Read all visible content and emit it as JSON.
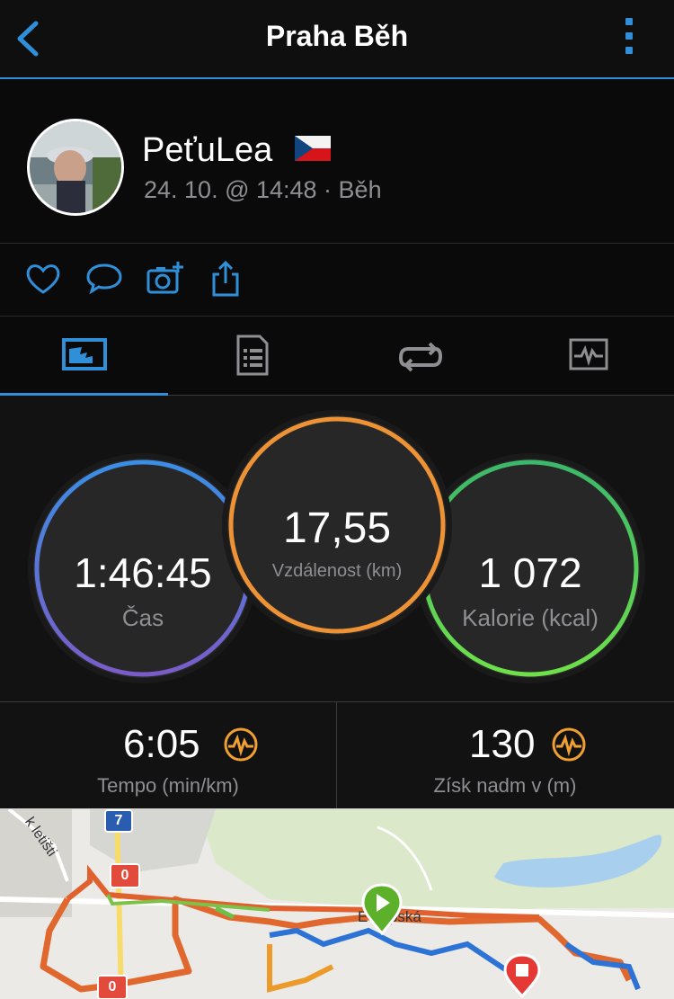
{
  "header": {
    "title": "Praha Běh"
  },
  "profile": {
    "username": "PeťuLea",
    "meta": "24. 10. @ 14:48 · Běh"
  },
  "stats": {
    "time": {
      "value": "1:46:45",
      "label": "Čas"
    },
    "distance": {
      "value": "17,55",
      "label": "Vzdálenost (km)"
    },
    "calories": {
      "value": "1 072",
      "label": "Kalorie (kcal)"
    }
  },
  "metrics": {
    "pace": {
      "value": "6:05",
      "label": "Tempo (min/km)"
    },
    "elevation": {
      "value": "130",
      "label": "Získ nadm v (m)"
    }
  },
  "map": {
    "road_label_1": "k letišti",
    "road_label_2": "Evropská",
    "route_badge_7": "7",
    "route_badge_0a": "0",
    "route_badge_0b": "0"
  },
  "colors": {
    "accent": "#2f8fd8",
    "pace_icon": "#f0a030"
  }
}
